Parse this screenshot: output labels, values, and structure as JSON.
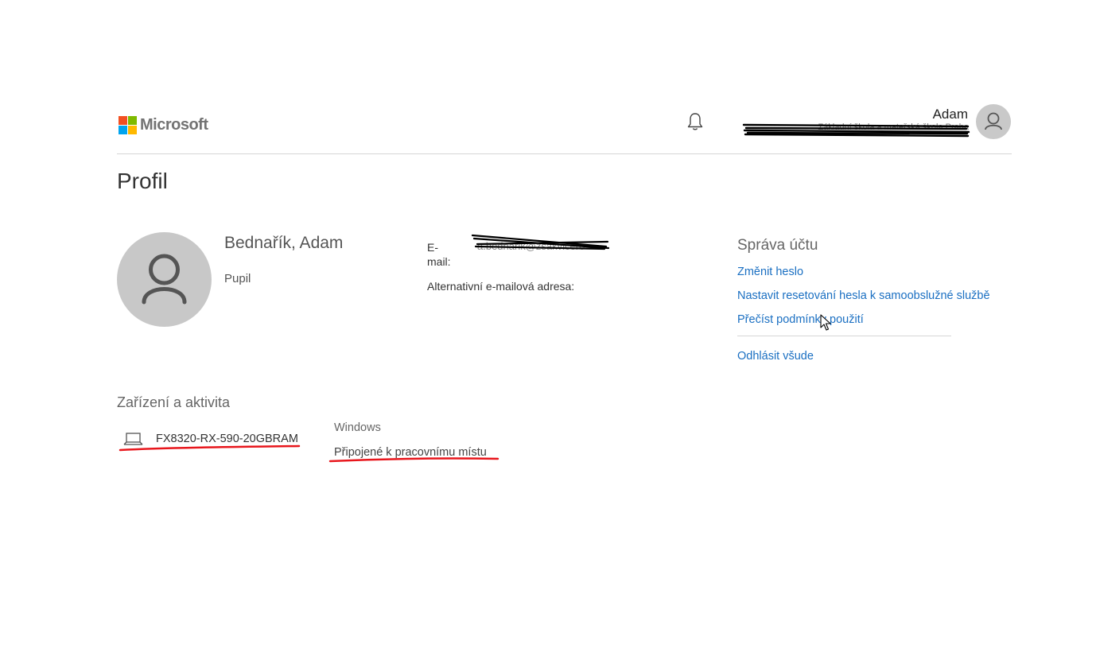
{
  "header": {
    "brand": "Microsoft",
    "user_name": "Adam",
    "user_org": "Základní škola a mateřská škola Praha",
    "icons": {
      "notifications": "bell-icon",
      "avatar": "person-icon"
    },
    "logo_colors": [
      "#f25022",
      "#7fba00",
      "#00a4ef",
      "#ffb900"
    ]
  },
  "page": {
    "title": "Profil"
  },
  "profile": {
    "full_name": "Bednařík, Adam",
    "role": "Pupil",
    "email_label": "E-mail:",
    "email_value": "a.bednarik@zsakvicero",
    "alt_email_label": "Alternativní e-mailová adresa:"
  },
  "account": {
    "title": "Správa účtu",
    "links": [
      "Změnit heslo",
      "Nastavit resetování hesla k samoobslužné službě",
      "Přečíst podmínky použití"
    ],
    "sign_out": "Odhlásit všude",
    "link_color": "#1a6fc2"
  },
  "devices": {
    "title": "Zařízení a aktivita",
    "items": [
      {
        "name": "FX8320-RX-590-20GBRAM",
        "os": "Windows",
        "status": "Připojené k pracovnímu místu",
        "icon": "laptop-icon"
      }
    ]
  }
}
